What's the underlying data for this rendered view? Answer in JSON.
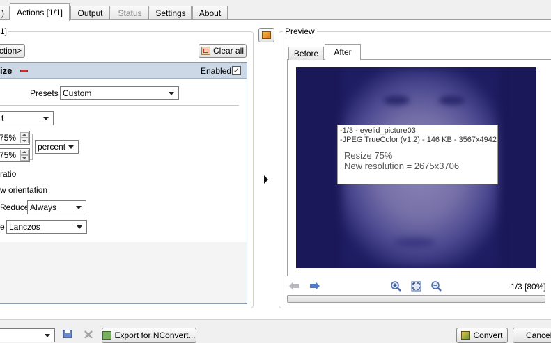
{
  "tabs": [
    {
      "label": ")",
      "state": "normal"
    },
    {
      "label": "Actions [1/1]",
      "state": "active"
    },
    {
      "label": "Output",
      "state": "normal"
    },
    {
      "label": "Status",
      "state": "disabled"
    },
    {
      "label": "Settings",
      "state": "normal"
    },
    {
      "label": "About",
      "state": "normal"
    }
  ],
  "left": {
    "group_title": "1]",
    "add_action_label": "ction>",
    "clear_all_label": "Clear all",
    "action": {
      "title": "ize",
      "enabled_label": "Enabled",
      "enabled": true,
      "presets_label": "Presets",
      "presets_value": "Custom",
      "mode_value": "t",
      "width_value": "75%",
      "height_value": "75%",
      "unit_value": "percent",
      "keep_ratio_label": "ratio",
      "orientation_label": "w orientation",
      "reduce_label": "Reduce",
      "reduce_value": "Always",
      "resample_label": "e",
      "resample_value": "Lanczos"
    }
  },
  "preview": {
    "title": "Preview",
    "tab_before": "Before",
    "tab_after": "After",
    "info_line1": "-1/3 - eyelid_picture03",
    "info_line2": "-JPEG TrueColor (v1.2) - 146 KB - 3567x4942",
    "info_line3": "Resize 75%",
    "info_line4": "New resolution = 2675x3706",
    "page_zoom": "1/3 [80%]"
  },
  "bottom": {
    "export_label": "Export for NConvert...",
    "convert_label": "Convert",
    "cancel_label": "Cancel"
  },
  "colors": {
    "action_header": "#cdd8e6",
    "preview_bg": "#1a1858",
    "accent_red": "#d03030"
  }
}
